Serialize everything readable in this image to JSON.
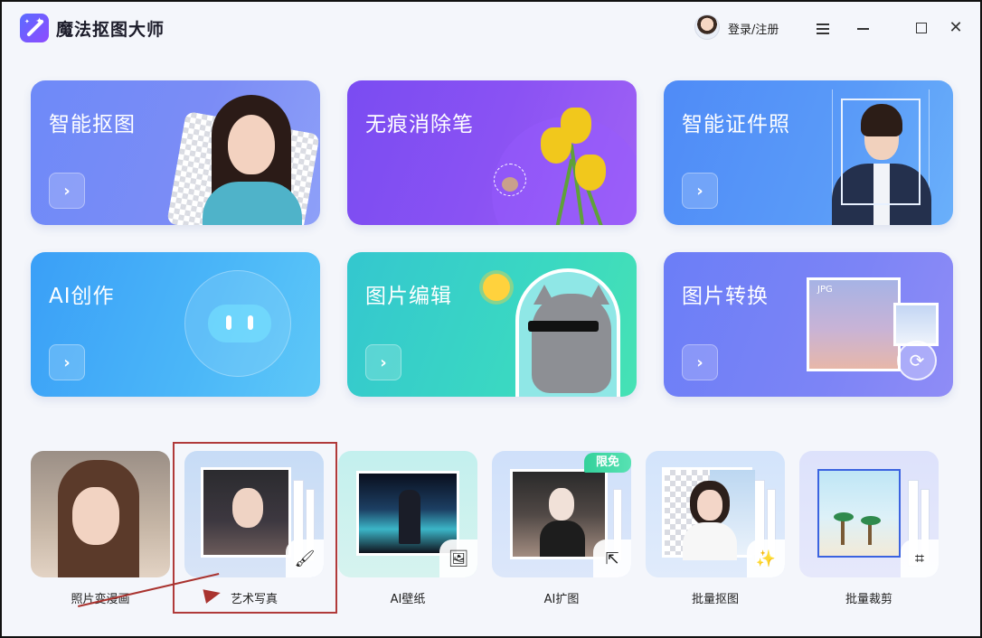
{
  "app": {
    "title": "魔法抠图大师",
    "logo_icon": "magic-wand-icon"
  },
  "header": {
    "login_label": "登录/注册",
    "menu_icon": "menu-icon",
    "minimize_icon": "minimize-icon",
    "maximize_icon": "maximize-icon",
    "close_icon": "close-icon",
    "close_glyph": "✕"
  },
  "cards": [
    {
      "title": "智能抠图",
      "arrow": "›"
    },
    {
      "title": "无痕消除笔",
      "arrow": "›"
    },
    {
      "title": "智能证件照",
      "arrow": "›"
    },
    {
      "title": "AI创作",
      "arrow": "›"
    },
    {
      "title": "图片编辑",
      "arrow": "›"
    },
    {
      "title": "图片转换",
      "arrow": "›",
      "photo_tag": "JPG"
    }
  ],
  "tools": [
    {
      "label": "照片变漫画"
    },
    {
      "label": "艺术写真",
      "corner_icon": "brush-icon"
    },
    {
      "label": "AI壁纸",
      "corner_icon": "image-icon"
    },
    {
      "label": "AI扩图",
      "corner_icon": "expand-icon",
      "badge": "限免"
    },
    {
      "label": "批量抠图",
      "corner_icon": "magic-wand-icon"
    },
    {
      "label": "批量裁剪",
      "corner_icon": "crop-icon"
    }
  ],
  "colors": {
    "highlight_box": "#b03a3a",
    "annotation_arrow": "#a9332f",
    "free_badge": "#33d19b"
  }
}
